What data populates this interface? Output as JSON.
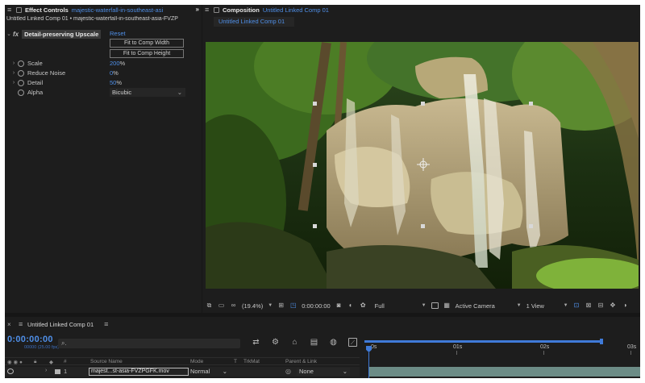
{
  "effect_controls": {
    "panel_title": "Effect Controls",
    "layer_link": "majestic-waterfall-in-southeast-asi",
    "more_icon": "»",
    "breadcrumb": "Untitled Linked Comp 01 • majestic-waterfall-in-southeast-asia-FVZP",
    "effect": {
      "fx_label": "fx",
      "name": "Detail-preserving Upscale",
      "reset_label": "Reset",
      "buttons": [
        "Fit to Comp Width",
        "Fit to Comp Height"
      ],
      "properties": [
        {
          "label": "Scale",
          "value": "200",
          "unit": "%"
        },
        {
          "label": "Reduce Noise",
          "value": "0",
          "unit": "%"
        },
        {
          "label": "Detail",
          "value": "50",
          "unit": "%"
        }
      ],
      "alpha": {
        "label": "Alpha",
        "value": "Bicubic"
      }
    }
  },
  "composition": {
    "panel_title": "Composition",
    "comp_link": "Untitled Linked Comp 01",
    "sub_tab": "Untitled Linked Comp 01",
    "toolbar": {
      "zoom": "(19.4%)",
      "timecode": "0:00:00:00",
      "resolution": "Full",
      "camera": "Active Camera",
      "view": "1 View"
    }
  },
  "timeline": {
    "panel_title": "Untitled Linked Comp 01",
    "timecode": "0:00:00:00",
    "fps": "00000 (25.00 fps)",
    "search_glyph": "⌕.",
    "ruler_labels": [
      "0s",
      "01s",
      "02s",
      "03s"
    ],
    "columns": {
      "hash": "#",
      "source_name": "Source Name",
      "mode": "Mode",
      "t": "T",
      "trkmat": "TrkMat",
      "parent": "Parent & Link"
    },
    "layer": {
      "number": "1",
      "name": "majest...st-asia-FVZPGFK.mov",
      "mode": "Normal",
      "parent": "None"
    }
  },
  "colors": {
    "accent_blue": "#4f8fe8",
    "panel_bg": "#1d1d1d",
    "layer_bar": "#6c8c86"
  }
}
